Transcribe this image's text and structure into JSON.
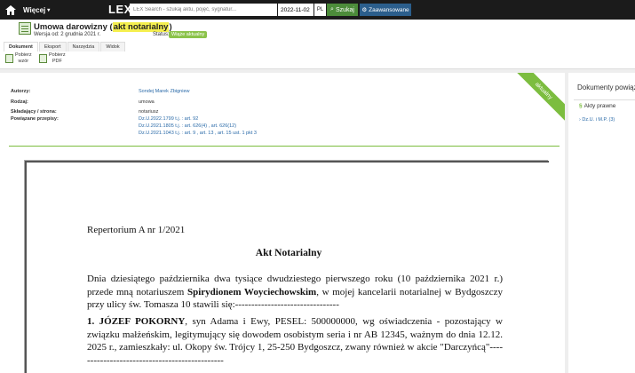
{
  "topbar": {
    "menu_label": "Więcej",
    "brand": "LEX",
    "search_placeholder": "LEX Search - szukaj aktu, pojęć, sygnatur...",
    "date": "2022-11-02",
    "lang": "PL",
    "search_label": "Szukaj",
    "advanced_label": "Zaawansowane"
  },
  "document": {
    "title_main": "Umowa darowizny",
    "title_paren_open": "(",
    "title_highlight": "akt notarialny",
    "title_paren_close": ")",
    "version": "Wersja od: 2 grudnia 2021 r.",
    "status_label": "Status:",
    "status_value": "Wiąże aktualny"
  },
  "tabs": [
    "Dokument",
    "Eksport",
    "Narzędzia",
    "Widok"
  ],
  "toolbar": {
    "tool1_line1": "Pobierz",
    "tool1_line2": "wzór",
    "tool2_line1": "Pobierz",
    "tool2_line2": "PDF"
  },
  "ribbon": "aktualny",
  "meta": {
    "authors_label": "Autorzy:",
    "authors_value": "Sondej Marek Zbigniew",
    "type_label": "Rodzaj:",
    "type_value": "umowa",
    "party_label": "Składający / strona:",
    "party_value": "notariusz",
    "related_label": "Powiązane przepisy:",
    "related": [
      "Dz.U.2022.1799 t.j. : art. 92",
      "Dz.U.2021.1805 t.j. : art. 626(4) , art. 626(12)",
      "Dz.U.2021.1043 t.j. : art. 9 , art. 13 , art. 15 ust. 1 pkt 3"
    ]
  },
  "paper": {
    "repertorium": "Repertorium A nr 1/2021",
    "act_title": "Akt Notarialny",
    "p1_before": "Dnia dziesiątego października dwa tysiące dwudziestego pierwszego roku (10 października 2021 r.) przede mną notariuszem ",
    "p1_bold": "Spirydionem Woyciechowskim",
    "p1_after": ", w mojej kancelarii notarialnej w Bydgoszczy przy ulicy św. Tomasza 10 stawili się:--------------------------------",
    "p2_bold": "1. JÓZEF POKORNY",
    "p2_after": ", syn Adama i Ewy, PESEL: 500000000, wg oświadczenia - pozostający w związku małżeńskim, legitymujący się dowodem osobistym seria i nr AB 12345, ważnym do dnia 12.12. 2025 r., zamieszkały: ul. Okopy św. Trójcy 1, 25-250 Bydgoszcz, zwany również w akcie \"Darczyńcą\"----------------------------------------------"
  },
  "side": {
    "title": "Dokumenty powiązane",
    "item": "Akty prawne",
    "sub": "Dz.U. i M.P. (3)"
  },
  "colors": {
    "topbar": "#1b1b1b",
    "accent_green": "#7cbd3f",
    "link": "#2a6aa8",
    "highlight": "#f5ef4f"
  }
}
